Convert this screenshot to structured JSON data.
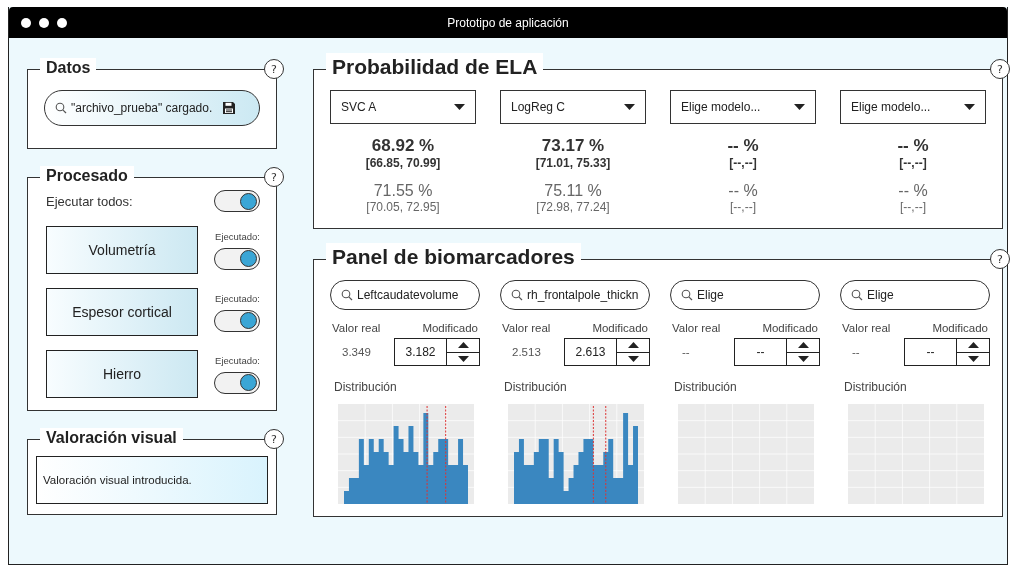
{
  "window": {
    "title": "Prototipo de aplicación"
  },
  "datos": {
    "title": "Datos",
    "help": "?",
    "file_field": {
      "value": "\"archivo_prueba\" cargado."
    }
  },
  "procesado": {
    "title": "Procesado",
    "help": "?",
    "run_all": {
      "label": "Ejecutar todos:",
      "on": true
    },
    "steps": [
      {
        "label": "Volumetría",
        "status_label": "Ejecutado:",
        "on": true
      },
      {
        "label": "Espesor cortical",
        "status_label": "Ejecutado:",
        "on": true
      },
      {
        "label": "Hierro",
        "status_label": "Ejecutado:",
        "on": true
      }
    ]
  },
  "valoracion": {
    "title": "Valoración visual",
    "help": "?",
    "field": {
      "value": "Valoración visual introducida."
    }
  },
  "probabilidad": {
    "title": "Probabilidad de ELA",
    "help": "?",
    "models": [
      {
        "selector": "SVC A",
        "primary": {
          "percent": "68.92 %",
          "interval": "[66.85, 70.99]"
        },
        "secondary": {
          "percent": "71.55 %",
          "interval": "[70.05, 72.95]"
        }
      },
      {
        "selector": "LogReg C",
        "primary": {
          "percent": "73.17 %",
          "interval": "[71.01, 75.33]"
        },
        "secondary": {
          "percent": "75.11 %",
          "interval": "[72.98, 77.24]"
        }
      },
      {
        "selector": "Elige modelo...",
        "primary": {
          "percent": "-- %",
          "interval": "[--,--]"
        },
        "secondary": {
          "percent": "-- %",
          "interval": "[--,--]"
        }
      },
      {
        "selector": "Elige modelo...",
        "primary": {
          "percent": "-- %",
          "interval": "[--,--]"
        },
        "secondary": {
          "percent": "-- %",
          "interval": "[--,--]"
        }
      }
    ]
  },
  "biomarcadores": {
    "title": "Panel de biomarcadores",
    "help": "?",
    "columns": [
      {
        "search": "Leftcaudatevolume",
        "real_label": "Valor real",
        "modified_label": "Modificado",
        "real_value": "3.349",
        "modified_value": "3.182",
        "distribution_label": "Distribución",
        "plot": {
          "kind": "histogram"
        }
      },
      {
        "search": "rh_frontalpole_thickn",
        "real_label": "Valor real",
        "modified_label": "Modificado",
        "real_value": "2.513",
        "modified_value": "2.613",
        "distribution_label": "Distribución",
        "plot": {
          "kind": "histogram"
        }
      },
      {
        "search": "Elige",
        "real_label": "Valor real",
        "modified_label": "Modificado",
        "real_value": "--",
        "modified_value": "--",
        "distribution_label": "Distribución",
        "plot": {
          "kind": "empty"
        }
      },
      {
        "search": "Elige",
        "real_label": "Valor real",
        "modified_label": "Modificado",
        "real_value": "--",
        "modified_value": "--",
        "distribution_label": "Distribución",
        "plot": {
          "kind": "empty"
        }
      }
    ]
  }
}
